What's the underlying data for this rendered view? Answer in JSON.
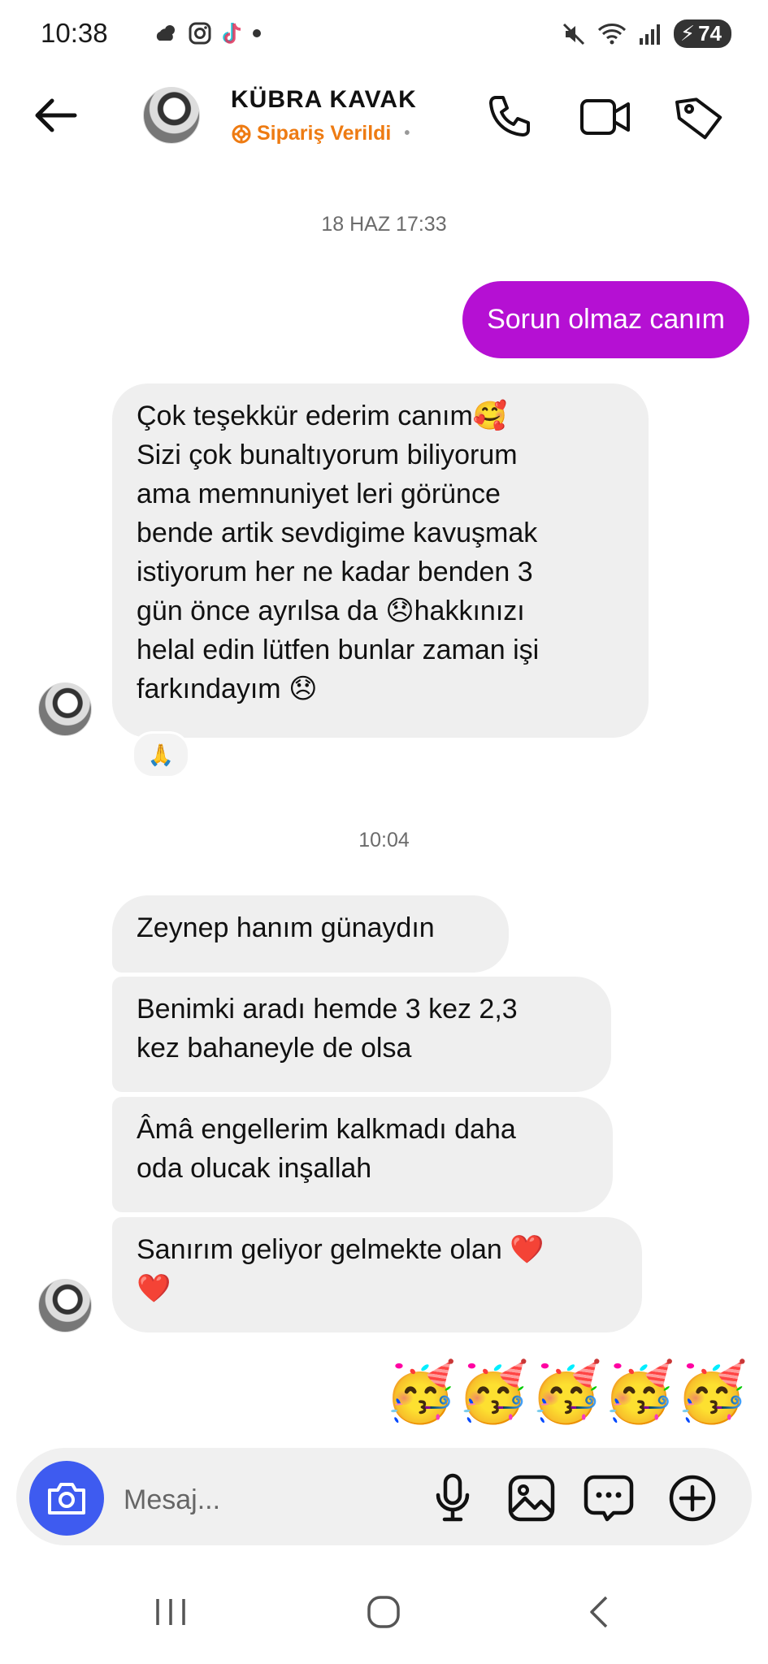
{
  "status_bar": {
    "time": "10:38",
    "battery": "74",
    "left_icons": [
      "weather-icon",
      "instagram-icon",
      "tiktok-icon",
      "dot"
    ],
    "right_icons": [
      "mute-icon",
      "wifi-icon",
      "signal-icon",
      "battery-icon"
    ]
  },
  "header": {
    "name": "KÜBRA KAVAK",
    "subtitle": "Sipariş Verildi",
    "subtitle_color": "#ee7b12",
    "icons": [
      "back-arrow-icon",
      "phone-icon",
      "video-icon",
      "tag-icon"
    ]
  },
  "conversation": {
    "timestamp_1": "18 HAZ 17:33",
    "outgoing_1": "Sorun olmaz canım",
    "incoming_1": {
      "lines": [
        "Çok teşekkür ederim canım🥰",
        "Sizi çok bunaltıyorum biliyorum",
        "ama memnuniyet leri görünce",
        "bende artik sevdigime kavuşmak",
        "istiyorum her ne kadar benden 3",
        "gün önce ayrılsa da 😞hakkınızı",
        "helal edin lütfen bunlar zaman işi",
        "farkındayım 😞"
      ],
      "reaction": "🙏"
    },
    "timestamp_2": "10:04",
    "incoming_group": [
      {
        "lines": [
          "Zeynep hanım günaydın"
        ]
      },
      {
        "lines": [
          "Benimki aradı hemde 3 kez 2,3",
          "kez bahaneyle de olsa"
        ]
      },
      {
        "lines": [
          "Âmâ engellerim kalkmadı daha",
          "oda olucak inşallah"
        ]
      },
      {
        "lines": [
          "Sanırım geliyor gelmekte olan ❤️",
          "❤️"
        ]
      }
    ],
    "outgoing_emojis": "🥳🥳🥳🥳🥳",
    "bubble_color_out": "#b510d3",
    "bubble_color_in": "#efefef"
  },
  "composer": {
    "placeholder": "Mesaj...",
    "camera_color": "#3e5bf0",
    "icons": [
      "camera-icon",
      "microphone-icon",
      "gallery-icon",
      "sticker-icon",
      "plus-icon"
    ]
  },
  "nav_bar": {
    "icons": [
      "recent-apps-icon",
      "home-icon",
      "back-icon"
    ]
  }
}
